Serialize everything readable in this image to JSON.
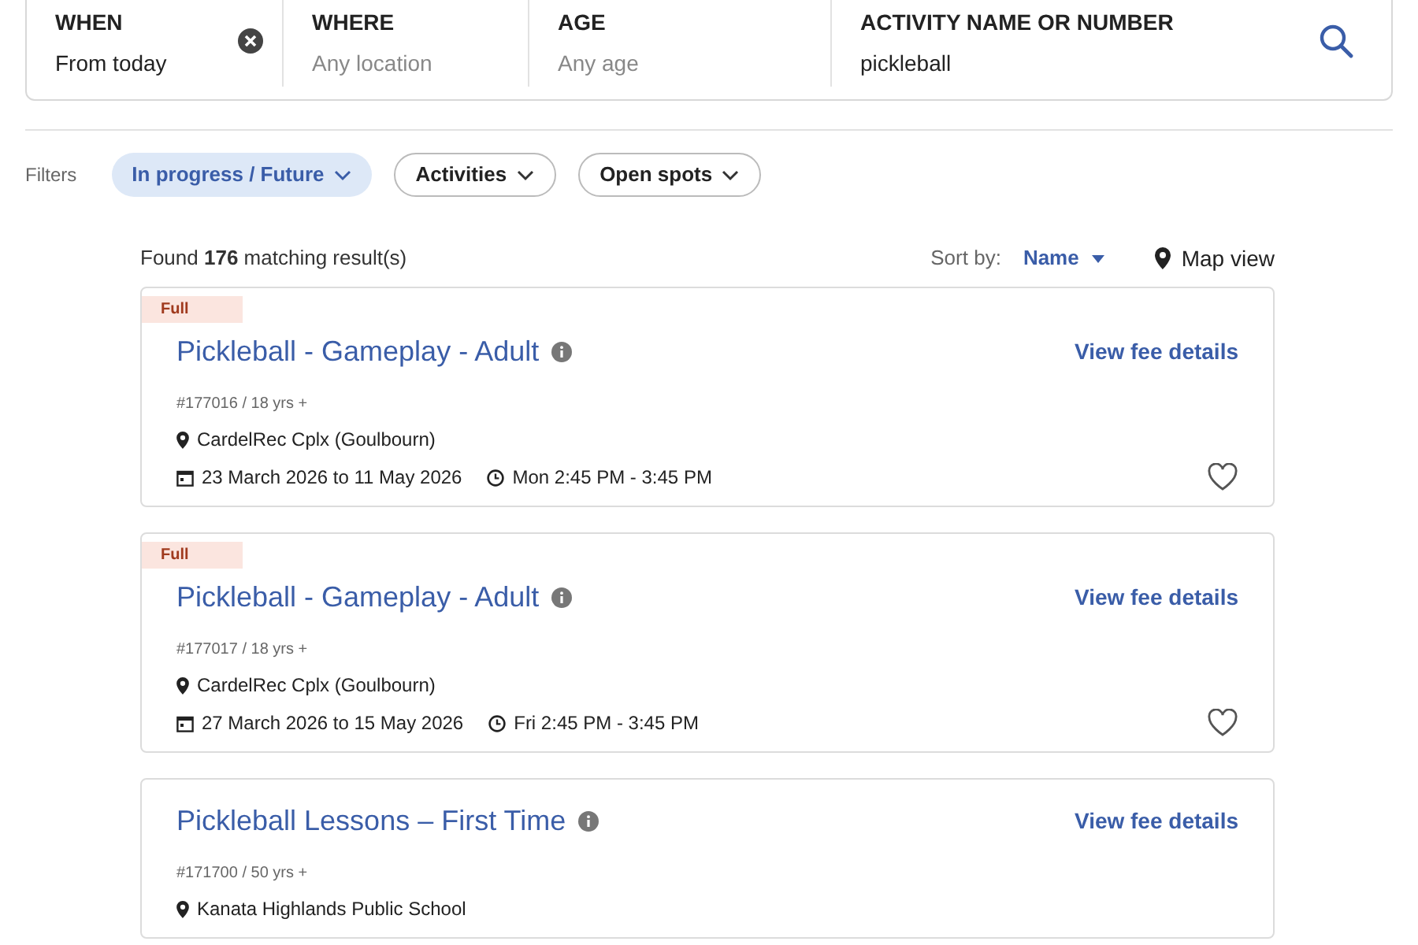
{
  "search_bar": {
    "fields": [
      {
        "label": "WHEN",
        "value": "From today",
        "clearable": true
      },
      {
        "label": "WHERE",
        "placeholder": "Any location"
      },
      {
        "label": "AGE",
        "placeholder": "Any age"
      },
      {
        "label": "ACTIVITY NAME OR NUMBER",
        "value": "pickleball"
      }
    ]
  },
  "filters": {
    "label": "Filters",
    "chips": [
      {
        "label": "In progress / Future",
        "selected": true
      },
      {
        "label": "Activities",
        "selected": false
      },
      {
        "label": "Open spots",
        "selected": false
      }
    ]
  },
  "results": {
    "count_text": "Found **176** matching result(s)",
    "sort_label": "Sort by:",
    "sort_value": "Name",
    "map_view": "Map view"
  },
  "cards": [
    {
      "badge": "Full",
      "title": "Pickleball - Gameplay - Adult",
      "fee_link": "View fee details",
      "meta": "#177016 / 18 yrs +",
      "location": "CardelRec Cplx (Goulbourn)",
      "dates": "23 March 2026 to 11 May 2026",
      "time": "Mon 2:45 PM - 3:45 PM",
      "favorite": false
    },
    {
      "badge": "Full",
      "title": "Pickleball - Gameplay - Adult",
      "fee_link": "View fee details",
      "meta": "#177017 / 18 yrs +",
      "location": "CardelRec Cplx (Goulbourn)",
      "dates": "27 March 2026 to 15 May 2026",
      "time": "Fri 2:45 PM - 3:45 PM",
      "favorite": false
    },
    {
      "title": "Pickleball Lessons – First Time",
      "fee_link": "View fee details",
      "meta": "#171700 / 50 yrs +",
      "location": "Kanata Highlands Public School"
    }
  ]
}
